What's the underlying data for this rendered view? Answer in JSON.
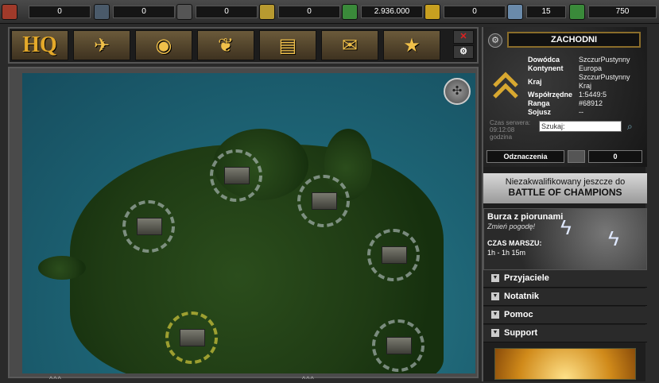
{
  "resources": [
    {
      "icon": "fuel-barrel-icon",
      "value": "0",
      "color": "#a03a2a"
    },
    {
      "icon": "oil-barrel-icon",
      "value": "0",
      "color": "#4a5a6a"
    },
    {
      "icon": "metal-barrel-icon",
      "value": "0",
      "color": "#555555"
    },
    {
      "icon": "ammo-icon",
      "value": "0",
      "color": "#b89a30"
    },
    {
      "icon": "money-icon",
      "value": "2.936.000",
      "color": "#3a8a3a"
    },
    {
      "icon": "gold-bar-icon",
      "value": "0",
      "color": "#c8a020"
    },
    {
      "icon": "diamond-icon",
      "value": "15",
      "color": "#6a8aaa"
    },
    {
      "icon": "rank-up-icon",
      "value": "750",
      "color": "#3a8a3a"
    }
  ],
  "nav": {
    "hq_label": "HQ",
    "buttons": [
      "units-icon",
      "globe-icon",
      "alliance-laurel-icon",
      "reports-icon",
      "mail-icon",
      "star-icon"
    ]
  },
  "player": {
    "name": "ZACHODNI",
    "fields": [
      {
        "k": "Dowódca",
        "v": "SzczurPustynny"
      },
      {
        "k": "Kontynent",
        "v": "Europa"
      },
      {
        "k": "Kraj",
        "v": "SzczurPustynny Kraj"
      },
      {
        "k": "Współrzędne",
        "v": "1:5449:5"
      },
      {
        "k": "Ranga",
        "v": "#68912"
      },
      {
        "k": "Sojusz",
        "v": "--"
      }
    ],
    "server_time_label": "Czas serwera:",
    "server_time_value": "09:12:08",
    "server_time_unit": "godzina",
    "search_placeholder": "Szukaj:",
    "awards_label": "Odznaczenia",
    "awards_count": "0"
  },
  "boc": {
    "line1": "Niezakwalifikowany jeszcze do",
    "line2": "BATTLE OF CHAMPIONS"
  },
  "weather": {
    "title": "Burza z piorunami",
    "change_link": "Zmień pogodę!",
    "march_label": "CZAS MARSZU:",
    "march_value": "1h - 1h 15m"
  },
  "menu": [
    "Przyjaciele",
    "Notatnik",
    "Pomoc",
    "Support"
  ],
  "edge_marks": [
    "^^^",
    "^^^",
    "^^^"
  ]
}
